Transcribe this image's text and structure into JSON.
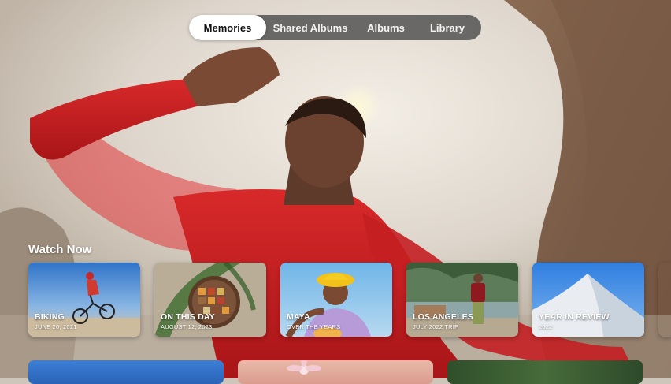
{
  "tabs": [
    {
      "label": "Memories",
      "active": true
    },
    {
      "label": "Shared Albums",
      "active": false
    },
    {
      "label": "Albums",
      "active": false
    },
    {
      "label": "Library",
      "active": false
    }
  ],
  "section": {
    "title": "Watch Now"
  },
  "cards": [
    {
      "title": "BIKING",
      "subtitle": "JUNE 20, 2021"
    },
    {
      "title": "ON THIS DAY",
      "subtitle": "AUGUST 12, 2023"
    },
    {
      "title": "MAYA",
      "subtitle": "OVER THE YEARS"
    },
    {
      "title": "LOS ANGELES",
      "subtitle": "JULY 2022 TRIP"
    },
    {
      "title": "YEAR IN REVIEW",
      "subtitle": "2022"
    }
  ],
  "colors": {
    "tab_bar_bg": "#464646",
    "tab_active_bg": "#ffffff",
    "text": "#ffffff"
  }
}
